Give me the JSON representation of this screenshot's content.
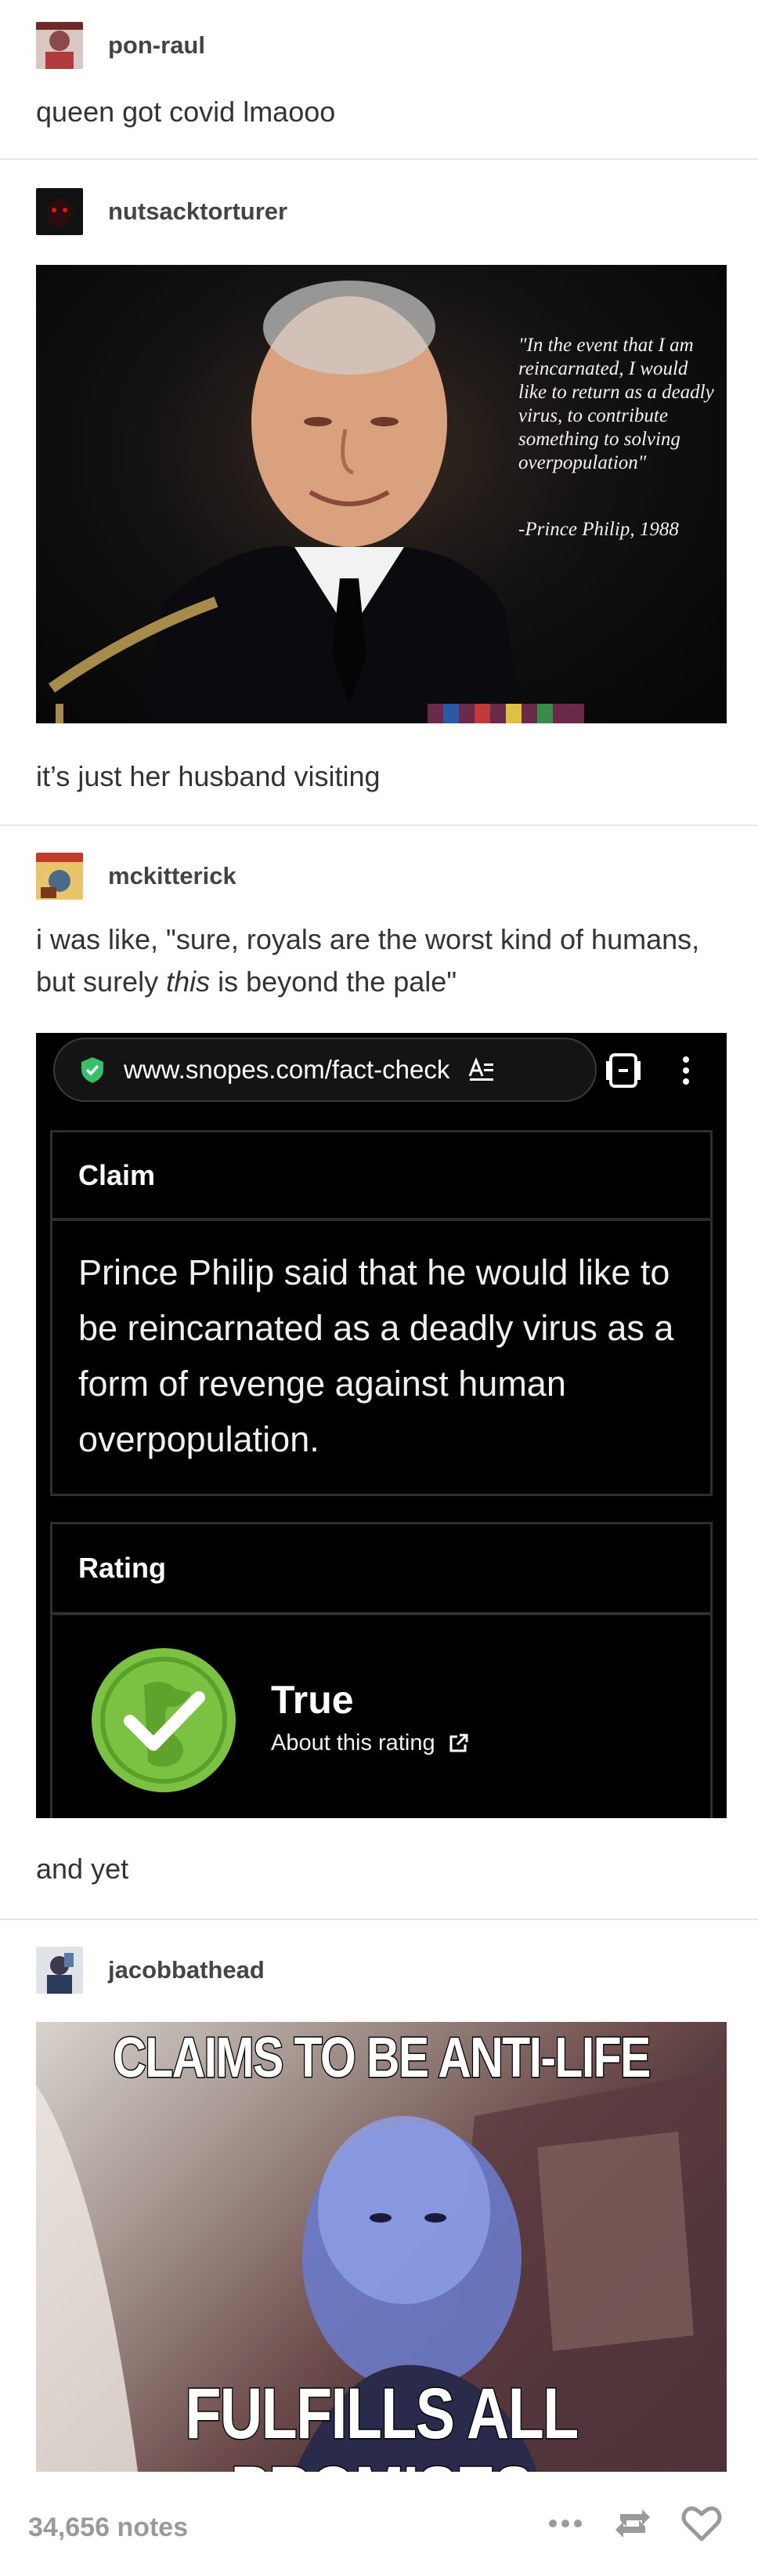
{
  "posts": [
    {
      "username": "pon-raul",
      "text": "queen got covid lmaooo"
    },
    {
      "username": "nutsacktorturer",
      "image_quote": "\"In the event that I am reincarnated, I would like to return as a deadly virus, to contribute something to solving overpopulation\"",
      "image_attribution": "-Prince Philip, 1988",
      "text": "it’s just her husband visiting"
    },
    {
      "username": "mckitterick",
      "text_before": "i was like, \"sure, royals are the worst kind of humans, but surely ",
      "text_emphasis": "this",
      "text_after": " is beyond the pale\"",
      "screenshot": {
        "url": "www.snopes.com/fact-check",
        "claim_label": "Claim",
        "claim_text": "Prince Philip said that he would like to be reincarnated as a deadly virus as a form of revenge against human overpopulation.",
        "rating_label": "Rating",
        "rating_value": "True",
        "rating_link": "About this rating"
      },
      "text": "and yet"
    },
    {
      "username": "jacobbathead",
      "meme_top": "Claims to be anti-life",
      "meme_bottom": "Fulfills all promises"
    }
  ],
  "footer": {
    "notes": "34,656 notes"
  },
  "colors": {
    "rating_green": "#7cc242",
    "divider": "#e8e8e8"
  }
}
